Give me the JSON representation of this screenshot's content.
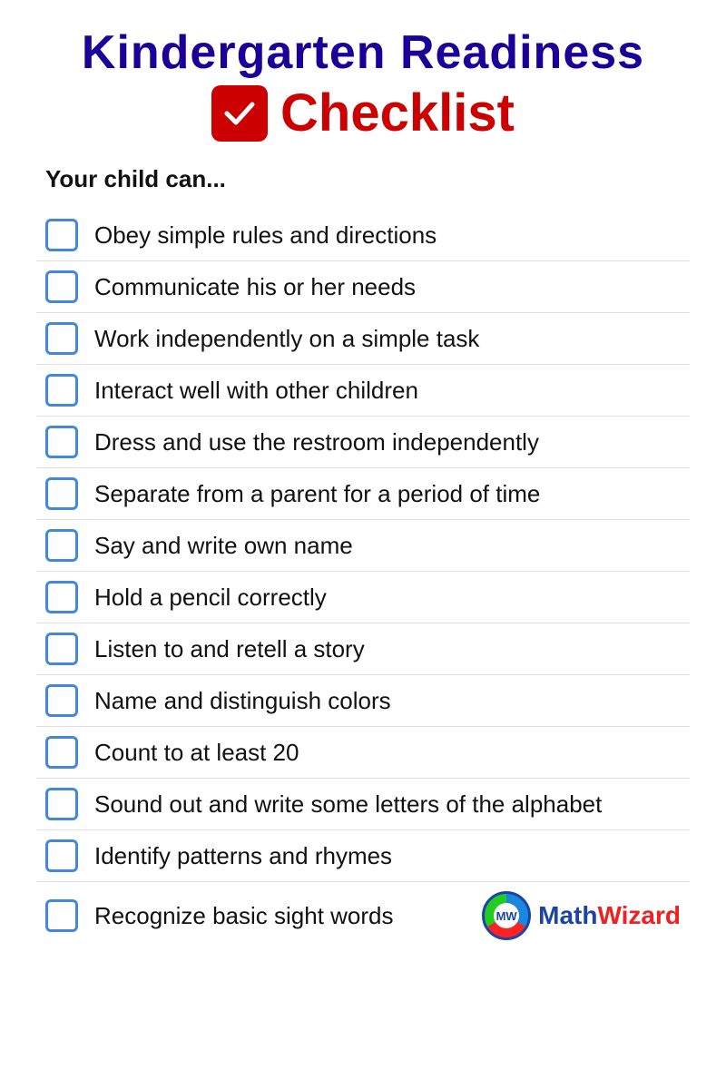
{
  "header": {
    "title_line1": "Kindergarten Readiness",
    "checklist_word": "Checklist"
  },
  "subtitle": "Your child can...",
  "items": [
    {
      "id": 1,
      "text": "Obey simple rules and directions"
    },
    {
      "id": 2,
      "text": "Communicate his or her needs"
    },
    {
      "id": 3,
      "text": "Work independently on a simple task"
    },
    {
      "id": 4,
      "text": "Interact well with other children"
    },
    {
      "id": 5,
      "text": "Dress and use the restroom independently"
    },
    {
      "id": 6,
      "text": "Separate from a parent for a period of time"
    },
    {
      "id": 7,
      "text": "Say and write own name"
    },
    {
      "id": 8,
      "text": "Hold a pencil correctly"
    },
    {
      "id": 9,
      "text": "Listen to and retell a story"
    },
    {
      "id": 10,
      "text": "Name and distinguish colors"
    },
    {
      "id": 11,
      "text": "Count to at least 20"
    },
    {
      "id": 12,
      "text": "Sound out and write some letters of the alphabet"
    },
    {
      "id": 13,
      "text": "Identify patterns and rhymes"
    },
    {
      "id": 14,
      "text": "Recognize basic sight words"
    }
  ],
  "logo": {
    "math": "Math",
    "wizard": "Wizard"
  }
}
